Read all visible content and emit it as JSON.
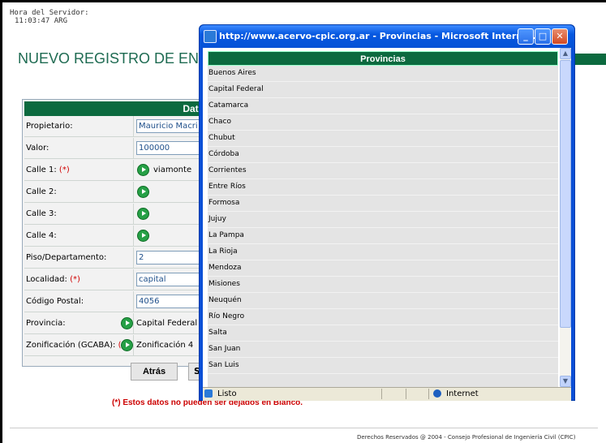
{
  "server": {
    "label": "Hora del Servidor:",
    "time": "11:03:47 ARG"
  },
  "page": {
    "title": "NUEVO REGISTRO DE ENC"
  },
  "form": {
    "header": "Dato",
    "rows": [
      {
        "label": "Propietario:",
        "value": "Mauricio Macri"
      },
      {
        "label": "Valor:",
        "value": "100000"
      },
      {
        "label": "Calle 1:",
        "req": "(*)",
        "value": "viamonte"
      },
      {
        "label": "Calle 2:"
      },
      {
        "label": "Calle 3:"
      },
      {
        "label": "Calle 4:"
      },
      {
        "label": "Piso/Departamento:",
        "value": "2"
      },
      {
        "label": "Localidad:",
        "req": "(*)",
        "value": "capital"
      },
      {
        "label": "Código Postal:",
        "value": "4056"
      },
      {
        "label": "Provincia:",
        "value": "Capital Federal"
      },
      {
        "label": "Zonificación (GCABA):",
        "req": "(*)",
        "value": "Zonificación 4"
      }
    ],
    "back_button": "Atrás",
    "second_button": "S",
    "warning": "(*) Estos datos no pueden ser dejados en Blanco."
  },
  "footer": {
    "text": "Derechos Reservados @ 2004 - Consejo Profesional de Ingeniería Civil (CPIC)"
  },
  "popup": {
    "title": "http://www.acervo-cpic.org.ar - Provincias - Microsoft Internet...",
    "header": "Provincias",
    "provinces": [
      "Buenos Aires",
      "Capital Federal",
      "Catamarca",
      "Chaco",
      "Chubut",
      "Córdoba",
      "Corrientes",
      "Entre Ríos",
      "Formosa",
      "Jujuy",
      "La Pampa",
      "La Rioja",
      "Mendoza",
      "Misiones",
      "Neuquén",
      "Río Negro",
      "Salta",
      "San Juan",
      "San Luis"
    ],
    "status": "Listo",
    "zone": "Internet",
    "minimize_glyph": "_",
    "maximize_glyph": "□",
    "close_glyph": "✕",
    "scroll_up_glyph": "▲",
    "scroll_down_glyph": "▼"
  },
  "colors": {
    "accent_green": "#0c6a3f",
    "xp_blue": "#0552d6",
    "required_red": "#cc0000"
  }
}
